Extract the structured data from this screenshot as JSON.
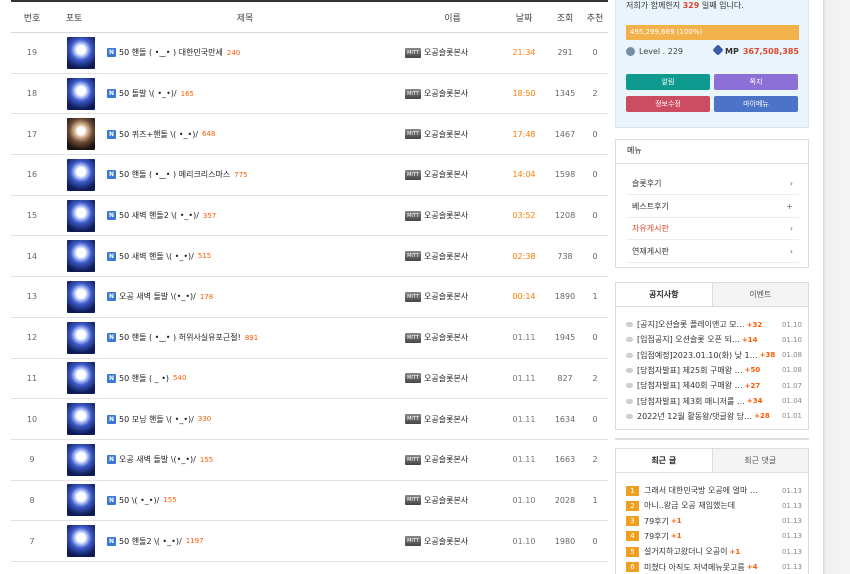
{
  "board": {
    "headers": {
      "no": "번호",
      "photo": "포토",
      "title": "제목",
      "name": "이름",
      "date": "날짜",
      "views": "조회",
      "rec": "추천"
    },
    "rows": [
      {
        "no": "19",
        "badge": "N",
        "title": "50 핸돌 ( •‿• ) 대한민국만세",
        "comments": "240",
        "level": "MITT",
        "name": "오공슬롯본사",
        "date": "21:34",
        "views": "291",
        "rec": "0",
        "thumb": "blue"
      },
      {
        "no": "18",
        "badge": "N",
        "title": "50 돌발 \\( •_•)/",
        "comments": "165",
        "level": "MITT",
        "name": "오공슬롯본사",
        "date": "18:50",
        "views": "1345",
        "rec": "2",
        "thumb": "blue"
      },
      {
        "no": "17",
        "badge": "N",
        "title": "50 퀴즈+핸돌 \\( •_•)/",
        "comments": "648",
        "level": "MITT",
        "name": "오공슬롯본사",
        "date": "17:48",
        "views": "1467",
        "rec": "0",
        "thumb": "alt"
      },
      {
        "no": "16",
        "badge": "N",
        "title": "50 핸돌 ( •‿• ) 메리크리스마스",
        "comments": "775",
        "level": "MITT",
        "name": "오공슬롯본사",
        "date": "14:04",
        "views": "1598",
        "rec": "0",
        "thumb": "blue"
      },
      {
        "no": "15",
        "badge": "N",
        "title": "50 새벽 핸돌2 \\( •_•)/",
        "comments": "357",
        "level": "MITT",
        "name": "오공슬롯본사",
        "date": "03:52",
        "views": "1208",
        "rec": "0",
        "thumb": "blue"
      },
      {
        "no": "14",
        "badge": "N",
        "title": "50 새벽 핸돌 \\( •_•)/",
        "comments": "515",
        "level": "MITT",
        "name": "오공슬롯본사",
        "date": "02:38",
        "views": "738",
        "rec": "0",
        "thumb": "blue"
      },
      {
        "no": "13",
        "badge": "N",
        "title": "오공 새벽 돌발 \\(•_•)/",
        "comments": "178",
        "level": "MITT",
        "name": "오공슬롯본사",
        "date": "00:14",
        "views": "1890",
        "rec": "1",
        "thumb": "blue"
      },
      {
        "no": "12",
        "badge": "N",
        "title": "50 핸돌 ( •‿• ) 허위사실유포근절!",
        "comments": "891",
        "level": "MITT",
        "name": "오공슬롯본사",
        "date": "01.11",
        "views": "1945",
        "rec": "0",
        "thumb": "blue"
      },
      {
        "no": "11",
        "badge": "N",
        "title": "50 핸돌 ( _ •)",
        "comments": "540",
        "level": "MITT",
        "name": "오공슬롯본사",
        "date": "01.11",
        "views": "827",
        "rec": "2",
        "thumb": "blue"
      },
      {
        "no": "10",
        "badge": "N",
        "title": "50 모닝 핸돌 \\( •_•)/",
        "comments": "330",
        "level": "MITT",
        "name": "오공슬롯본사",
        "date": "01.11",
        "views": "1634",
        "rec": "0",
        "thumb": "blue"
      },
      {
        "no": "9",
        "badge": "N",
        "title": "오공 새벽 돌발 \\(•_•)/",
        "comments": "155",
        "level": "MITT",
        "name": "오공슬롯본사",
        "date": "01.11",
        "views": "1663",
        "rec": "2",
        "thumb": "blue"
      },
      {
        "no": "8",
        "badge": "N",
        "title": "50 \\( •_•)/",
        "comments": "155",
        "level": "MITT",
        "name": "오공슬롯본사",
        "date": "01.10",
        "views": "2028",
        "rec": "1",
        "thumb": "blue"
      },
      {
        "no": "7",
        "badge": "N",
        "title": "50 핸돌2 \\( •_•)/",
        "comments": "1197",
        "level": "MITT",
        "name": "오공슬롯본사",
        "date": "01.10",
        "views": "1980",
        "rec": "0",
        "thumb": "blue"
      }
    ]
  },
  "sidebar": {
    "days_prefix": "저희가 함께한지",
    "days_value": "329",
    "days_suffix": "일째 입니다.",
    "exp_text": "495,299,669 (100%)",
    "exp_percent": 100,
    "level_label": "Level . 229",
    "mp_label": "MP",
    "mp_value": "367,508,385",
    "buttons": {
      "attend": "알림",
      "note": "쪽지",
      "info": "정보수정",
      "mymenu": "마이메뉴"
    },
    "menu": {
      "title": "메뉴",
      "items": [
        {
          "label": "슬롯후기",
          "arrow": "›"
        },
        {
          "label": "베스트후기",
          "arrow": "+"
        },
        {
          "label": "자유게시판",
          "arrow": "›"
        },
        {
          "label": "연재게시판",
          "arrow": "›"
        }
      ]
    },
    "notice": {
      "tabs": [
        "공지사항",
        "이벤트"
      ],
      "items": [
        {
          "text": "[공지]오션슬롯 플레이앤고 모…",
          "cmt": "+32",
          "date": "01.10"
        },
        {
          "text": "[입점공지] 오션슬롯 오픈 되…",
          "cmt": "+14",
          "date": "01.10"
        },
        {
          "text": "[입점예정]2023.01.10(화) 낮 1…",
          "cmt": "+38",
          "date": "01.08"
        },
        {
          "text": "[당첨자발표] 제25회 구매왕 …",
          "cmt": "+50",
          "date": "01.08"
        },
        {
          "text": "[당첨자발표] 제40회 구매왕 …",
          "cmt": "+27",
          "date": "01.07"
        },
        {
          "text": "[당첨자발표] 제3회 매니저룰 …",
          "cmt": "+34",
          "date": "01.04"
        },
        {
          "text": "2022년 12월 활동왕/댓글왕 당…",
          "cmt": "+28",
          "date": "01.01"
        }
      ]
    },
    "recent": {
      "tabs": [
        "최근 글",
        "최근 댓글"
      ],
      "items": [
        {
          "rank": "1",
          "text": "그래서 대한민국방 오공에 얼마 …",
          "cmt": "",
          "date": "01.13"
        },
        {
          "rank": "2",
          "text": "아니..왕금 오공 재입했는데",
          "cmt": "",
          "date": "01.13"
        },
        {
          "rank": "3",
          "text": "79후기",
          "cmt": "+1",
          "date": "01.13"
        },
        {
          "rank": "4",
          "text": "79후기",
          "cmt": "+1",
          "date": "01.13"
        },
        {
          "rank": "5",
          "text": "설거지하고왔더니 오공이",
          "cmt": "+1",
          "date": "01.13"
        },
        {
          "rank": "6",
          "text": "미쳤다 아직도 저녁메뉴못고름",
          "cmt": "+4",
          "date": "01.13"
        }
      ]
    }
  }
}
